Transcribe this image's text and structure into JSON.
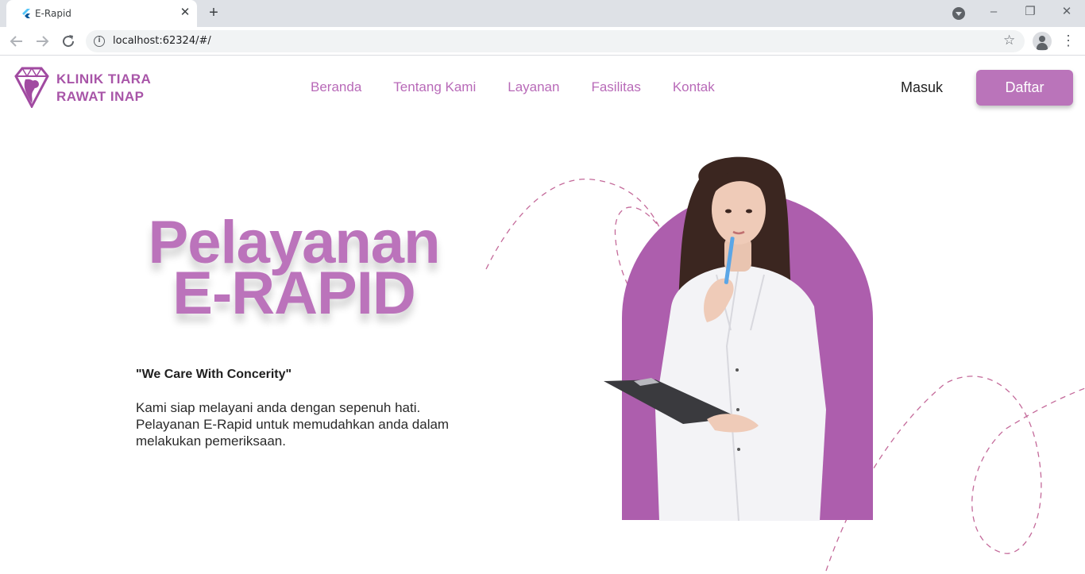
{
  "browser": {
    "tab_title": "E-Rapid",
    "tab_close": "✕",
    "new_tab": "+",
    "url": "localhost:62324/#/",
    "window_minimize": "–",
    "window_restore": "❐",
    "window_close": "✕"
  },
  "header": {
    "logo_line1": "KLINIK TIARA",
    "logo_line2": "RAWAT INAP",
    "nav": [
      "Beranda",
      "Tentang Kami",
      "Layanan",
      "Fasilitas",
      "Kontak"
    ],
    "login": "Masuk",
    "register": "Daftar"
  },
  "hero": {
    "title_line1": "Pelayanan",
    "title_line2": "E-RAPID",
    "tagline": "\"We Care With Concerity\"",
    "description": "Kami siap melayani anda dengan sepenuh hati. Pelayanan E-Rapid untuk memudahkan anda dalam melakukan pemeriksaan."
  },
  "colors": {
    "brand": "#bb73bb",
    "brand_dark": "#ad5ead",
    "button": "#ba74ba"
  }
}
